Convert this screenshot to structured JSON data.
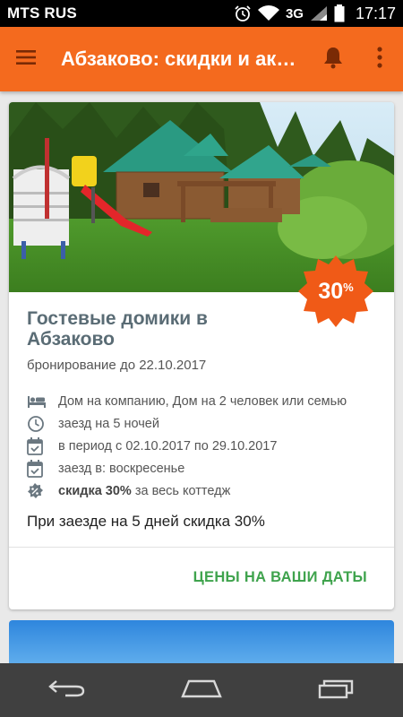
{
  "status_bar": {
    "carrier": "MTS RUS",
    "network": "3G",
    "time": "17:17",
    "icons": [
      "alarm-icon",
      "wifi-icon",
      "signal-icon",
      "battery-icon"
    ]
  },
  "app_bar": {
    "title": "Абзаково: скидки и акц...",
    "icons": [
      "menu-icon",
      "bell-icon",
      "more-vert-icon"
    ],
    "color": "#f46a1e"
  },
  "offer": {
    "discount_badge": "30",
    "discount_unit": "%",
    "title": "Гостевые домики в Абзаково",
    "subtitle": "бронирование до 22.10.2017",
    "features": [
      {
        "icon": "bed-icon",
        "text": "Дом на компанию, Дом на 2 человек или семью"
      },
      {
        "icon": "clock-icon",
        "text": "заезд на 5 ночей"
      },
      {
        "icon": "calendar-check-icon",
        "text": "в период с 02.10.2017 по 29.10.2017"
      },
      {
        "icon": "calendar-check-icon",
        "text": "заезд в: воскресенье"
      },
      {
        "icon": "percent-badge-icon",
        "bold": "скидка 30%",
        "text": " за весь коттедж"
      }
    ],
    "description": "При заезде на 5 дней скидка 30%",
    "cta_label": "ЦЕНЫ НА ВАШИ ДАТЫ",
    "cta_color": "#3fa34d"
  },
  "nav_bar": {
    "icons": [
      "back-icon",
      "home-icon",
      "recent-apps-icon"
    ]
  }
}
